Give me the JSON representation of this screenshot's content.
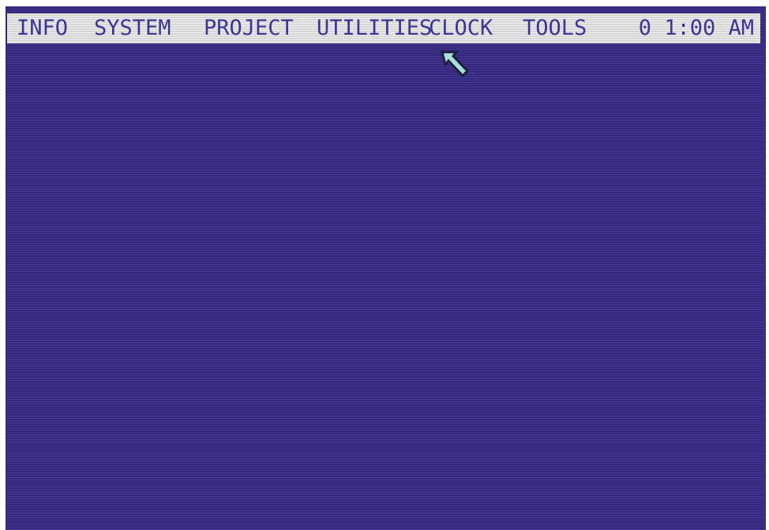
{
  "menubar": {
    "items": [
      {
        "label": "INFO"
      },
      {
        "label": "SYSTEM"
      },
      {
        "label": "PROJECT"
      },
      {
        "label": "UTILITIES"
      },
      {
        "label": "CLOCK"
      },
      {
        "label": "TOOLS"
      }
    ],
    "time": "0 1:00 AM"
  },
  "desktop": {
    "background_color": "#3a2c88"
  },
  "menubar_color": "#e4e4e4",
  "text_color": "#3e3494",
  "pointer": {
    "icon": "arrow-pointer-icon",
    "color": "#a8e0d8"
  }
}
